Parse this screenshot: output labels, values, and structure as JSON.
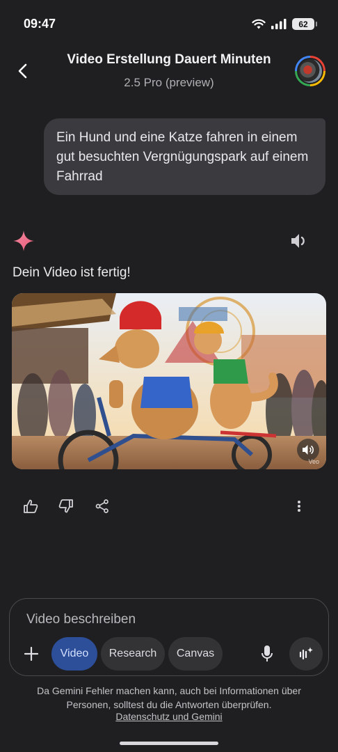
{
  "status_bar": {
    "time": "09:47",
    "battery": "62"
  },
  "header": {
    "title": "Video Erstellung Dauert Minuten",
    "model": "2.5 Pro (preview)"
  },
  "conversation": {
    "user_prompt": "Ein Hund und eine Katze fahren in einem gut besuchten Vergnügungspark auf einem Fahrrad",
    "response_text": "Dein Video ist fertig!",
    "video_watermark": "Veo"
  },
  "composer": {
    "placeholder": "Video beschreiben",
    "chips": {
      "video": "Video",
      "research": "Research",
      "canvas": "Canvas"
    }
  },
  "footer": {
    "disclaimer": "Da Gemini Fehler machen kann, auch bei Informationen über Personen, solltest du die Antworten überprüfen.",
    "privacy_link": "Datenschutz und Gemini"
  },
  "colors": {
    "background": "#1f1f21",
    "bubble": "#3b3b3f",
    "active_chip": "#2d4f9a",
    "gemini_spark": "#f0728a"
  },
  "icons": [
    "back-arrow-icon",
    "avatar",
    "gemini-spark-icon",
    "speaker-icon",
    "thumbs-up-icon",
    "thumbs-down-icon",
    "share-icon",
    "more-vert-icon",
    "plus-icon",
    "mic-icon",
    "live-icon",
    "wifi-icon",
    "signal-icon"
  ]
}
